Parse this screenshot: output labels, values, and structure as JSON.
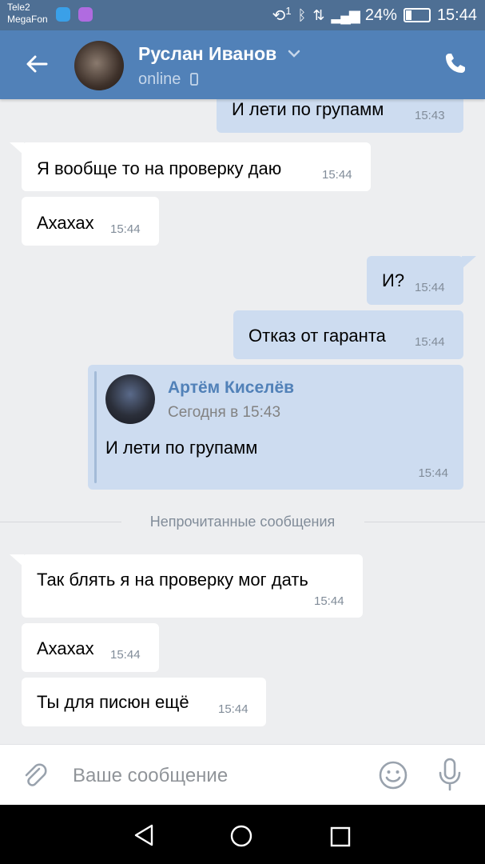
{
  "status_bar": {
    "carrier_1": "Tele2",
    "carrier_2": "MegaFon",
    "sim_number": "1",
    "battery": "24%",
    "time": "15:44"
  },
  "header": {
    "contact_name": "Руслан Иванов",
    "status": "online"
  },
  "messages": [
    {
      "dir": "out",
      "text": "И лети по групамм",
      "time": "15:43"
    },
    {
      "dir": "in",
      "text": "Я вообще то на проверку даю",
      "time": "15:44"
    },
    {
      "dir": "in",
      "text": "Ахахах",
      "time": "15:44"
    },
    {
      "dir": "out",
      "text": "И?",
      "time": "15:44"
    },
    {
      "dir": "out",
      "text": "Отказ от гаранта",
      "time": "15:44"
    },
    {
      "dir": "in",
      "text": "Так блять я на проверку мог дать",
      "time": "15:44"
    },
    {
      "dir": "in",
      "text": "Ахахах",
      "time": "15:44"
    },
    {
      "dir": "in",
      "text": "Ты для писюн ещё",
      "time": "15:44"
    }
  ],
  "forwarded": {
    "author": "Артём Киселёв",
    "date": "Сегодня в 15:43",
    "text": "И лети по групамм",
    "time": "15:44"
  },
  "unread_divider": "Непрочитанные сообщения",
  "composer": {
    "placeholder": "Ваше сообщение"
  },
  "colors": {
    "header_bg": "#5181b8",
    "status_bg": "#4e6f94",
    "chat_bg": "#edeef0",
    "outgoing_bubble": "#cddcf0",
    "incoming_bubble": "#ffffff",
    "accent": "#5181b8"
  },
  "icons": [
    "back-arrow-icon",
    "chevron-down-icon",
    "phone-icon",
    "mobile-device-icon",
    "paperclip-icon",
    "emoji-icon",
    "microphone-icon",
    "nav-back-icon",
    "nav-home-icon",
    "nav-recents-icon"
  ]
}
